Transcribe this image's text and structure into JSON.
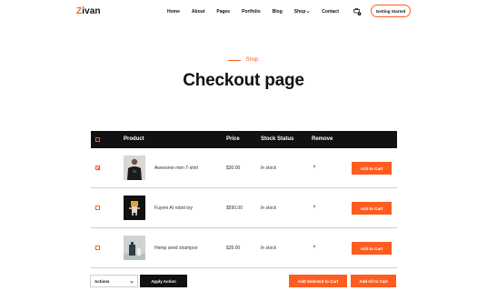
{
  "brand": {
    "logo_z": "Z",
    "logo_rest": "ivan",
    "accent": "#ff5c1f"
  },
  "nav": {
    "items": [
      {
        "label": "Home"
      },
      {
        "label": "About"
      },
      {
        "label": "Pages"
      },
      {
        "label": "Portfolio"
      },
      {
        "label": "Blog"
      },
      {
        "label": "Shop"
      },
      {
        "label": "Contact"
      }
    ],
    "cart_icon": "cart-icon",
    "cta_label": "Getting Started"
  },
  "hero": {
    "breadcrumb": "Shop",
    "title": "Checkout page"
  },
  "table": {
    "headers": {
      "product": "Product",
      "price": "Price",
      "stock": "Stock Status",
      "remove": "Remove"
    },
    "rows": [
      {
        "checked": true,
        "name": "Awesome men T-shirt",
        "price": "$30.00",
        "stock": "In stock",
        "remove": "×",
        "button": "Add to Cart"
      },
      {
        "checked": false,
        "name": "Fuyem AI robot toy",
        "price": "$590.00",
        "stock": "In stock",
        "remove": "×",
        "button": "Add to Cart"
      },
      {
        "checked": false,
        "name": "Hemp seed shampoo",
        "price": "$35.00",
        "stock": "In stock",
        "remove": "×",
        "button": "Add to Cart"
      }
    ]
  },
  "footer": {
    "actions_value": "Actions",
    "apply_label": "Apply Action",
    "add_selected_label": "Add Selected to Cart",
    "add_all_label": "Add All to Cart"
  }
}
